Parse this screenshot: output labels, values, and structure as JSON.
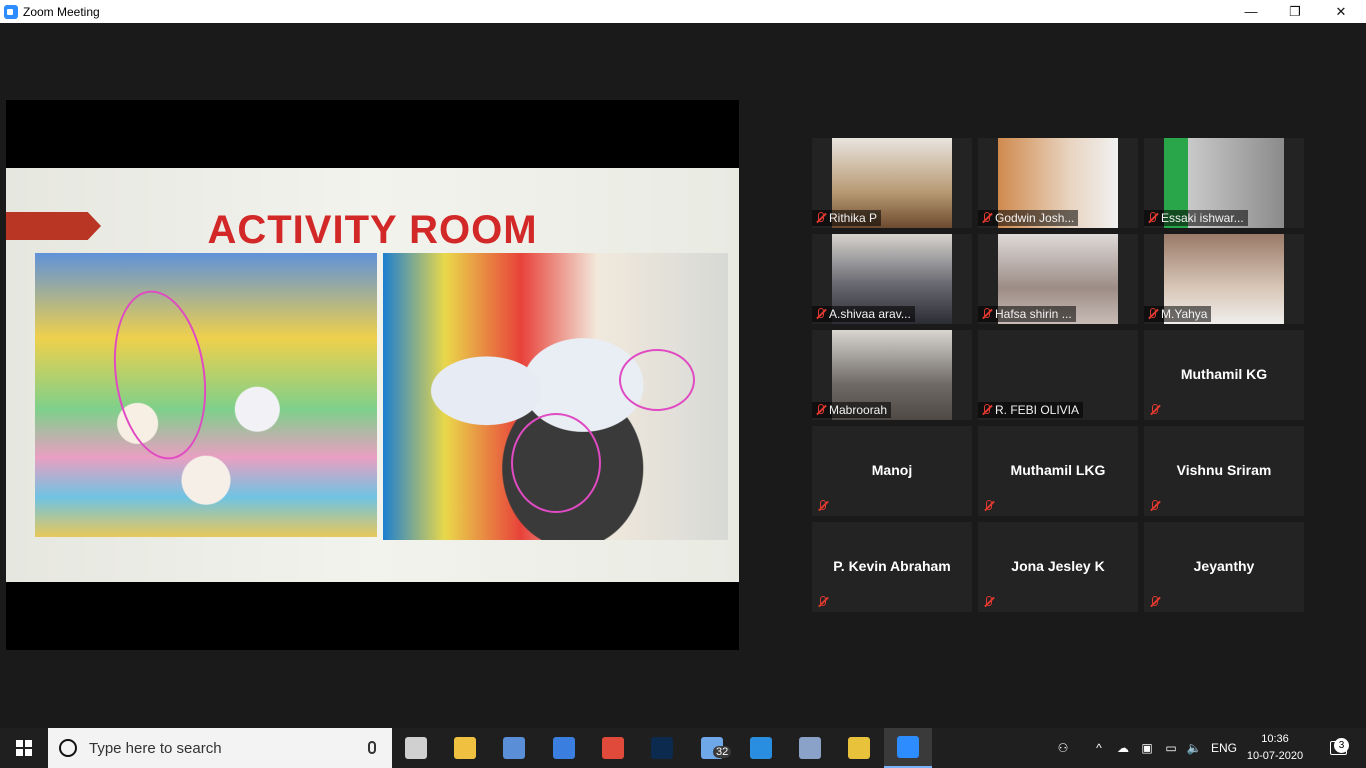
{
  "window": {
    "title": "Zoom Meeting",
    "minimize_glyph": "—",
    "restore_glyph": "❐",
    "close_glyph": "✕"
  },
  "shared_screen": {
    "slide_title": "ACTIVITY ROOM"
  },
  "participants": [
    {
      "name": "Rithika P",
      "video": true,
      "muted": true
    },
    {
      "name": "Godwin Josh...",
      "video": true,
      "muted": true
    },
    {
      "name": "Essaki ishwar...",
      "video": true,
      "muted": true
    },
    {
      "name": "A.shivaa arav...",
      "video": true,
      "muted": true
    },
    {
      "name": "Hafsa shirin ...",
      "video": true,
      "muted": true
    },
    {
      "name": "M.Yahya",
      "video": true,
      "muted": true
    },
    {
      "name": "Mabroorah",
      "video": true,
      "muted": true
    },
    {
      "name": "R. FEBI  OLIVIA",
      "video": false,
      "muted": true
    },
    {
      "name": "Muthamil KG",
      "video": false,
      "muted": true
    },
    {
      "name": "Manoj",
      "video": false,
      "muted": true
    },
    {
      "name": "Muthamil LKG",
      "video": false,
      "muted": true
    },
    {
      "name": "Vishnu Sriram",
      "video": false,
      "muted": true
    },
    {
      "name": "P. Kevin Abraham",
      "video": false,
      "muted": true
    },
    {
      "name": "Jona Jesley K",
      "video": false,
      "muted": true
    },
    {
      "name": "Jeyanthy",
      "video": false,
      "muted": true
    }
  ],
  "taskbar": {
    "search_placeholder": "Type here to search",
    "apps": [
      {
        "icon": "task-view-icon",
        "color": "#d0d0d0"
      },
      {
        "icon": "file-explorer-icon",
        "color": "#f0c040"
      },
      {
        "icon": "store-icon",
        "color": "#5a8fd8"
      },
      {
        "icon": "mail-icon",
        "color": "#3a7ee0"
      },
      {
        "icon": "chrome-icon",
        "color": "#e04a3a"
      },
      {
        "icon": "photoshop-icon",
        "color": "#0c2a4e"
      },
      {
        "icon": "document-icon",
        "color": "#6fa8e8"
      },
      {
        "icon": "edge-icon",
        "color": "#2a8ee0"
      },
      {
        "icon": "app-icon",
        "color": "#8aa2c8"
      },
      {
        "icon": "bell-app-icon",
        "color": "#e8c23a"
      },
      {
        "icon": "zoom-icon",
        "color": "#2d8cff"
      }
    ],
    "document_badge": "32",
    "language": "ENG",
    "time": "10:36",
    "date": "10-07-2020",
    "notification_count": "3"
  }
}
